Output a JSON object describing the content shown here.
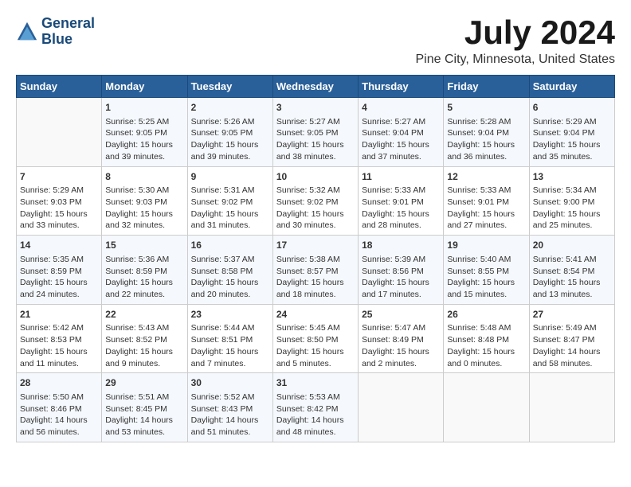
{
  "header": {
    "logo_line1": "General",
    "logo_line2": "Blue",
    "month_title": "July 2024",
    "location": "Pine City, Minnesota, United States"
  },
  "calendar": {
    "weekdays": [
      "Sunday",
      "Monday",
      "Tuesday",
      "Wednesday",
      "Thursday",
      "Friday",
      "Saturday"
    ],
    "weeks": [
      [
        {
          "day": "",
          "content": ""
        },
        {
          "day": "1",
          "content": "Sunrise: 5:25 AM\nSunset: 9:05 PM\nDaylight: 15 hours\nand 39 minutes."
        },
        {
          "day": "2",
          "content": "Sunrise: 5:26 AM\nSunset: 9:05 PM\nDaylight: 15 hours\nand 39 minutes."
        },
        {
          "day": "3",
          "content": "Sunrise: 5:27 AM\nSunset: 9:05 PM\nDaylight: 15 hours\nand 38 minutes."
        },
        {
          "day": "4",
          "content": "Sunrise: 5:27 AM\nSunset: 9:04 PM\nDaylight: 15 hours\nand 37 minutes."
        },
        {
          "day": "5",
          "content": "Sunrise: 5:28 AM\nSunset: 9:04 PM\nDaylight: 15 hours\nand 36 minutes."
        },
        {
          "day": "6",
          "content": "Sunrise: 5:29 AM\nSunset: 9:04 PM\nDaylight: 15 hours\nand 35 minutes."
        }
      ],
      [
        {
          "day": "7",
          "content": "Sunrise: 5:29 AM\nSunset: 9:03 PM\nDaylight: 15 hours\nand 33 minutes."
        },
        {
          "day": "8",
          "content": "Sunrise: 5:30 AM\nSunset: 9:03 PM\nDaylight: 15 hours\nand 32 minutes."
        },
        {
          "day": "9",
          "content": "Sunrise: 5:31 AM\nSunset: 9:02 PM\nDaylight: 15 hours\nand 31 minutes."
        },
        {
          "day": "10",
          "content": "Sunrise: 5:32 AM\nSunset: 9:02 PM\nDaylight: 15 hours\nand 30 minutes."
        },
        {
          "day": "11",
          "content": "Sunrise: 5:33 AM\nSunset: 9:01 PM\nDaylight: 15 hours\nand 28 minutes."
        },
        {
          "day": "12",
          "content": "Sunrise: 5:33 AM\nSunset: 9:01 PM\nDaylight: 15 hours\nand 27 minutes."
        },
        {
          "day": "13",
          "content": "Sunrise: 5:34 AM\nSunset: 9:00 PM\nDaylight: 15 hours\nand 25 minutes."
        }
      ],
      [
        {
          "day": "14",
          "content": "Sunrise: 5:35 AM\nSunset: 8:59 PM\nDaylight: 15 hours\nand 24 minutes."
        },
        {
          "day": "15",
          "content": "Sunrise: 5:36 AM\nSunset: 8:59 PM\nDaylight: 15 hours\nand 22 minutes."
        },
        {
          "day": "16",
          "content": "Sunrise: 5:37 AM\nSunset: 8:58 PM\nDaylight: 15 hours\nand 20 minutes."
        },
        {
          "day": "17",
          "content": "Sunrise: 5:38 AM\nSunset: 8:57 PM\nDaylight: 15 hours\nand 18 minutes."
        },
        {
          "day": "18",
          "content": "Sunrise: 5:39 AM\nSunset: 8:56 PM\nDaylight: 15 hours\nand 17 minutes."
        },
        {
          "day": "19",
          "content": "Sunrise: 5:40 AM\nSunset: 8:55 PM\nDaylight: 15 hours\nand 15 minutes."
        },
        {
          "day": "20",
          "content": "Sunrise: 5:41 AM\nSunset: 8:54 PM\nDaylight: 15 hours\nand 13 minutes."
        }
      ],
      [
        {
          "day": "21",
          "content": "Sunrise: 5:42 AM\nSunset: 8:53 PM\nDaylight: 15 hours\nand 11 minutes."
        },
        {
          "day": "22",
          "content": "Sunrise: 5:43 AM\nSunset: 8:52 PM\nDaylight: 15 hours\nand 9 minutes."
        },
        {
          "day": "23",
          "content": "Sunrise: 5:44 AM\nSunset: 8:51 PM\nDaylight: 15 hours\nand 7 minutes."
        },
        {
          "day": "24",
          "content": "Sunrise: 5:45 AM\nSunset: 8:50 PM\nDaylight: 15 hours\nand 5 minutes."
        },
        {
          "day": "25",
          "content": "Sunrise: 5:47 AM\nSunset: 8:49 PM\nDaylight: 15 hours\nand 2 minutes."
        },
        {
          "day": "26",
          "content": "Sunrise: 5:48 AM\nSunset: 8:48 PM\nDaylight: 15 hours\nand 0 minutes."
        },
        {
          "day": "27",
          "content": "Sunrise: 5:49 AM\nSunset: 8:47 PM\nDaylight: 14 hours\nand 58 minutes."
        }
      ],
      [
        {
          "day": "28",
          "content": "Sunrise: 5:50 AM\nSunset: 8:46 PM\nDaylight: 14 hours\nand 56 minutes."
        },
        {
          "day": "29",
          "content": "Sunrise: 5:51 AM\nSunset: 8:45 PM\nDaylight: 14 hours\nand 53 minutes."
        },
        {
          "day": "30",
          "content": "Sunrise: 5:52 AM\nSunset: 8:43 PM\nDaylight: 14 hours\nand 51 minutes."
        },
        {
          "day": "31",
          "content": "Sunrise: 5:53 AM\nSunset: 8:42 PM\nDaylight: 14 hours\nand 48 minutes."
        },
        {
          "day": "",
          "content": ""
        },
        {
          "day": "",
          "content": ""
        },
        {
          "day": "",
          "content": ""
        }
      ]
    ]
  }
}
